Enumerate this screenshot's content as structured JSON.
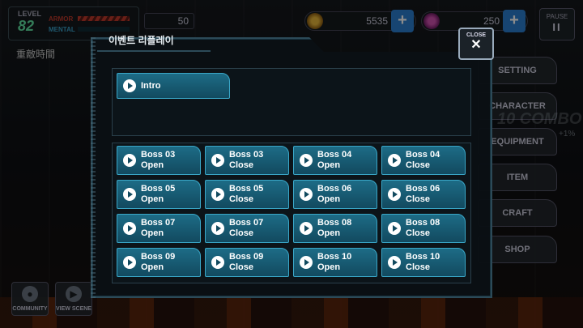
{
  "hud": {
    "level_label": "LEVEL",
    "level_value": "82",
    "armor_label": "ARMOR",
    "mental_label": "MENTAL",
    "small_value": "50",
    "kanji": "重敵時間",
    "gold_value": "5535",
    "gem_value": "250",
    "plus": "+",
    "pause_label": "PAUSE",
    "pause_icon": "II"
  },
  "side_menu": [
    "SETTING",
    "CHARACTER",
    "EQUIPMENT",
    "ITEM",
    "CRAFT",
    "SHOP"
  ],
  "combo": "10 COMBO",
  "combo_pct": "+1%",
  "bottom_buttons": [
    {
      "label": "COMMUNITY",
      "icon": "community-icon"
    },
    {
      "label": "VIEW SCENE",
      "icon": "play-icon"
    }
  ],
  "modal": {
    "title": "이벤트 리플레이",
    "close_label": "CLOSE",
    "close_icon": "✕",
    "intro": "Intro",
    "replays": [
      {
        "line1": "Boss 03",
        "line2": "Open"
      },
      {
        "line1": "Boss 03",
        "line2": "Close"
      },
      {
        "line1": "Boss 04",
        "line2": "Open"
      },
      {
        "line1": "Boss 04",
        "line2": "Close"
      },
      {
        "line1": "Boss 05",
        "line2": "Open"
      },
      {
        "line1": "Boss 05",
        "line2": "Close"
      },
      {
        "line1": "Boss 06",
        "line2": "Open"
      },
      {
        "line1": "Boss 06",
        "line2": "Close"
      },
      {
        "line1": "Boss 07",
        "line2": "Open"
      },
      {
        "line1": "Boss 07",
        "line2": "Close"
      },
      {
        "line1": "Boss 08",
        "line2": "Open"
      },
      {
        "line1": "Boss 08",
        "line2": "Close"
      },
      {
        "line1": "Boss 09",
        "line2": "Open"
      },
      {
        "line1": "Boss 09",
        "line2": "Close"
      },
      {
        "line1": "Boss 10",
        "line2": "Open"
      },
      {
        "line1": "Boss 10",
        "line2": "Close"
      }
    ]
  },
  "colors": {
    "accent": "#1d6c86",
    "border": "#3aa7c8"
  }
}
